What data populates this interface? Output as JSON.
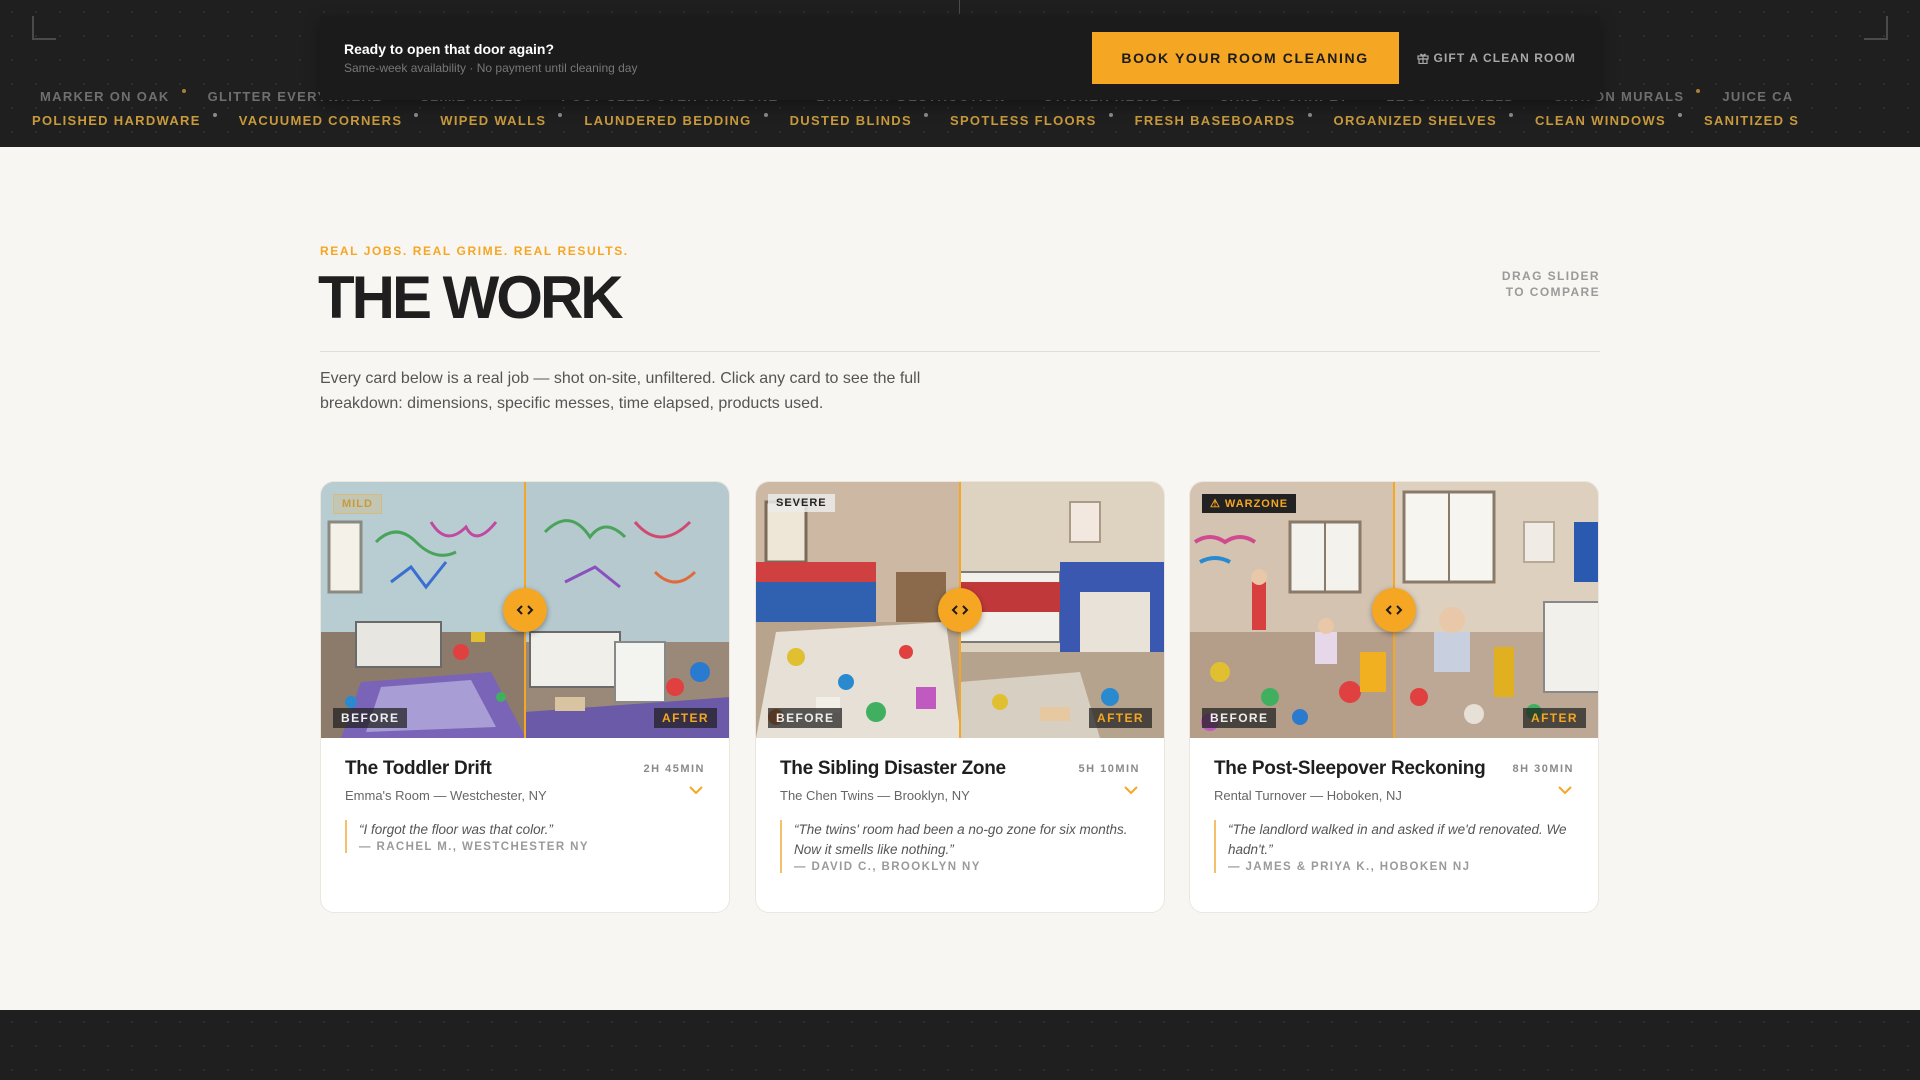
{
  "marquee": {
    "row1": [
      "Marker on Oak",
      "Glitter Everywhere",
      "Slime Walls",
      "Post-Sleepover Warzone",
      "Birthday Destruction",
      "Sticker Residue",
      "Sand in Carpet",
      "Lego Minefield",
      "Crayon Murals",
      "Juice Ca"
    ],
    "row2": [
      "Polished Hardware",
      "Vacuumed Corners",
      "Wiped Walls",
      "Laundered Bedding",
      "Dusted Blinds",
      "Spotless Floors",
      "Fresh Baseboards",
      "Organized Shelves",
      "Clean Windows",
      "Sanitized S"
    ]
  },
  "cta": {
    "title": "Ready to open that door again?",
    "subtitle": "Same-week availability · No payment until cleaning day",
    "book_label": "BOOK YOUR ROOM CLEANING",
    "gift_label": "GIFT A CLEAN ROOM",
    "accent_color": "#f5a623"
  },
  "section": {
    "eyebrow": "REAL JOBS. REAL GRIME. REAL RESULTS.",
    "title": "THE WORK",
    "drag_hint_line1": "DRAG SLIDER",
    "drag_hint_line2": "TO COMPARE",
    "intro": "Every card below is a real job — shot on-site, unfiltered. Click any card to see the full breakdown: dimensions, specific messes, time elapsed, products used."
  },
  "cards": [
    {
      "severity": "MILD",
      "title": "The Toddler Drift",
      "subtitle": "Emma's Room — Westchester, NY",
      "duration": "2H 45MIN",
      "quote": "“I forgot the floor was that color.”",
      "author": "— RACHEL M., WESTCHESTER NY",
      "before_label": "BEFORE",
      "after_label": "AFTER",
      "comparison_split": 0.5
    },
    {
      "severity": "SEVERE",
      "title": "The Sibling Disaster Zone",
      "subtitle": "The Chen Twins — Brooklyn, NY",
      "duration": "5H 10MIN",
      "quote": "“The twins' room had been a no-go zone for six months. Now it smells like nothing.”",
      "author": "— DAVID C., BROOKLYN NY",
      "before_label": "BEFORE",
      "after_label": "AFTER",
      "comparison_split": 0.5
    },
    {
      "severity": "⚠ WARZONE",
      "title": "The Post-Sleepover Reckoning",
      "subtitle": "Rental Turnover — Hoboken, NJ",
      "duration": "8H 30MIN",
      "quote": "“The landlord walked in and asked if we'd renovated. We hadn't.”",
      "author": "— JAMES & PRIYA K., HOBOKEN NJ",
      "before_label": "BEFORE",
      "after_label": "AFTER",
      "comparison_split": 0.5
    }
  ]
}
